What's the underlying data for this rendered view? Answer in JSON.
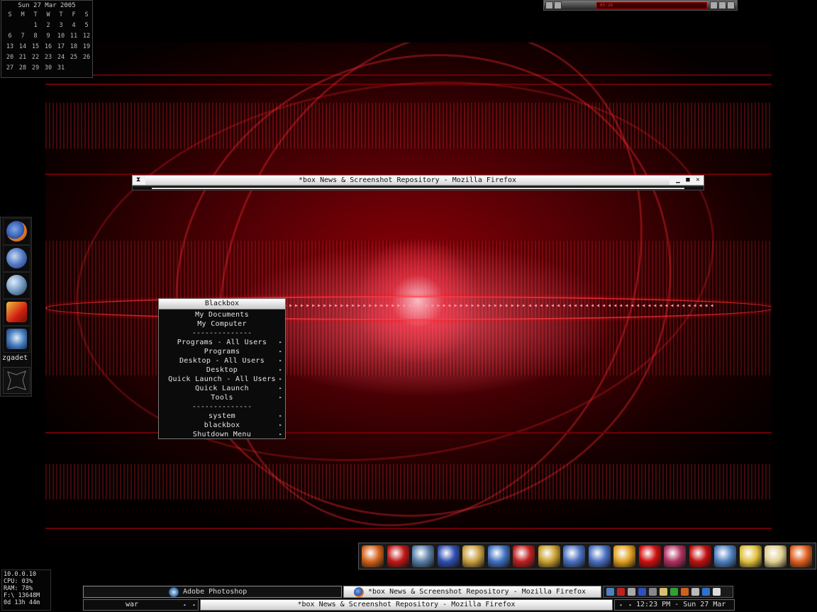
{
  "calendar": {
    "title": "Sun 27 Mar 2005",
    "weekdays": [
      "S",
      "M",
      "T",
      "W",
      "T",
      "F",
      "S"
    ],
    "weeks": [
      [
        "",
        "",
        "1",
        "2",
        "3",
        "4",
        "5"
      ],
      [
        "6",
        "7",
        "8",
        "9",
        "10",
        "11",
        "12"
      ],
      [
        "13",
        "14",
        "15",
        "16",
        "17",
        "18",
        "19"
      ],
      [
        "20",
        "21",
        "22",
        "23",
        "24",
        "25",
        "26"
      ],
      [
        "27",
        "28",
        "29",
        "30",
        "31",
        "",
        ""
      ]
    ]
  },
  "media_player": {
    "time": "05:26"
  },
  "firefox_window": {
    "title": "*box News & Screenshot Repository - Mozilla Firefox",
    "menu_glyph": "⧗",
    "minimize_glyph": "▁",
    "maximize_glyph": "■",
    "close_glyph": "✕"
  },
  "launcher": {
    "items": [
      {
        "icon": "firefox-icon"
      },
      {
        "icon": "thunderbird-icon"
      },
      {
        "icon": "search-glasses-icon"
      },
      {
        "icon": "flashget-icon"
      },
      {
        "icon": "photoshop-icon"
      }
    ],
    "label": "zgadet"
  },
  "blackbox_menu": {
    "title": "Blackbox",
    "items": [
      {
        "label": "My Documents",
        "submenu": false
      },
      {
        "label": "My Computer",
        "submenu": false
      },
      {
        "label": "--------------",
        "separator": true
      },
      {
        "label": "Programs - All Users",
        "submenu": true
      },
      {
        "label": "Programs",
        "submenu": true
      },
      {
        "label": "Desktop - All Users",
        "submenu": true
      },
      {
        "label": "Desktop",
        "submenu": true
      },
      {
        "label": "Quick Launch - All Users",
        "submenu": true
      },
      {
        "label": "Quick Launch",
        "submenu": true
      },
      {
        "label": "Tools",
        "submenu": true
      },
      {
        "label": "--------------",
        "separator": true
      },
      {
        "label": "system",
        "submenu": true
      },
      {
        "label": "blackbox",
        "submenu": true
      },
      {
        "label": "Shutdown Menu",
        "submenu": true
      }
    ],
    "submenu_arrow": "▸"
  },
  "icon_tray": {
    "icons": [
      {
        "name": "winamp-fire-icon",
        "color": "#d4621a"
      },
      {
        "name": "nero-icon",
        "color": "#c01818"
      },
      {
        "name": "shuttle-icon",
        "color": "#5b7fa8"
      },
      {
        "name": "media-player-classic-icon",
        "color": "#3050b0"
      },
      {
        "name": "notepad-icon",
        "color": "#c8a040"
      },
      {
        "name": "network-globe-icon",
        "color": "#4070c0"
      },
      {
        "name": "red-circle-icon",
        "color": "#c02020"
      },
      {
        "name": "c-drive-icon",
        "color": "#c8a030"
      },
      {
        "name": "network-computer-icon",
        "color": "#4a70c0"
      },
      {
        "name": "network-computer-2-icon",
        "color": "#4a70c0"
      },
      {
        "name": "lightning-icon",
        "color": "#e0a020"
      },
      {
        "name": "red-splat-icon",
        "color": "#d01010"
      },
      {
        "name": "cartridge-icon",
        "color": "#b03060"
      },
      {
        "name": "mplab-ide-icon",
        "color": "#c01010"
      },
      {
        "name": "monitor-icon",
        "color": "#5080c0"
      },
      {
        "name": "pt-icon",
        "color": "#e0c040"
      },
      {
        "name": "sheep-icon",
        "color": "#e0d090"
      },
      {
        "name": "fox-icon",
        "color": "#e06020"
      }
    ]
  },
  "sysinfo": {
    "ip": "10.0.0.10",
    "cpu": "CPU: 03%",
    "ram": "RAM: 78%",
    "disk": "F:\\ 13648M",
    "uptime": "0d 13h 44m"
  },
  "taskbar": {
    "tasks": [
      {
        "label": "Adobe Photoshop",
        "icon": "photoshop-icon",
        "active": false
      },
      {
        "label": "*box News & Screenshot Repository - Mozilla Firefox",
        "icon": "firefox-icon",
        "active": true
      }
    ],
    "workspace": "war",
    "current_window": "*box News & Screenshot Repository - Mozilla Firefox",
    "clock": "12:23 PM - Sun 27 Mar",
    "arrow_left": "◂",
    "arrow_right": "▸"
  },
  "colors": {
    "accent_red": "#c00010",
    "menu_title_bg": "#e8e8e8"
  }
}
